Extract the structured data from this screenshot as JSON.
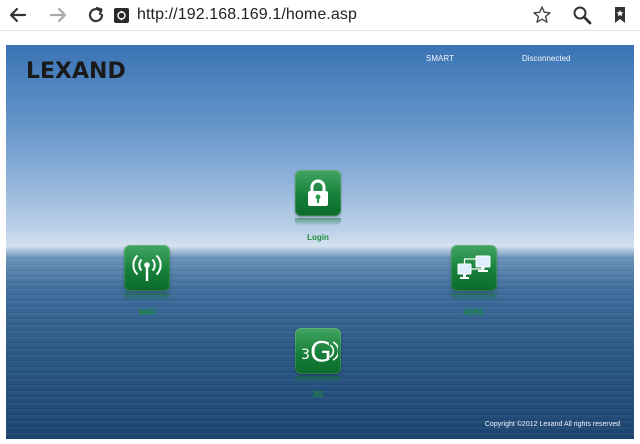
{
  "browser": {
    "url": "http://192.168.169.1/home.asp",
    "icons": [
      "back-arrow-icon",
      "forward-arrow-icon",
      "reload-icon",
      "site-favicon",
      "star-bookmark-icon",
      "search-icon",
      "bookmarks-icon"
    ]
  },
  "header": {
    "logo": "LEXAND",
    "mode": "SMART",
    "connection_status": "Disconnected"
  },
  "tiles": {
    "login": {
      "label": "Login",
      "icon": "padlock-icon"
    },
    "wifi": {
      "label": "WIFI",
      "icon": "wifi-antenna-icon"
    },
    "adsl": {
      "label": "ADSL",
      "icon": "network-computers-icon"
    },
    "threeg": {
      "label": "3G",
      "icon": "3g-signal-icon",
      "glyph_small": "3",
      "glyph_big": "G"
    }
  },
  "footer": {
    "copyright": "Copyright ©2012 Lexand All rights reserved"
  },
  "colors": {
    "tile_green": "#158039",
    "label_green": "#1a8a3a",
    "sky_blue": "#3a73b4"
  }
}
